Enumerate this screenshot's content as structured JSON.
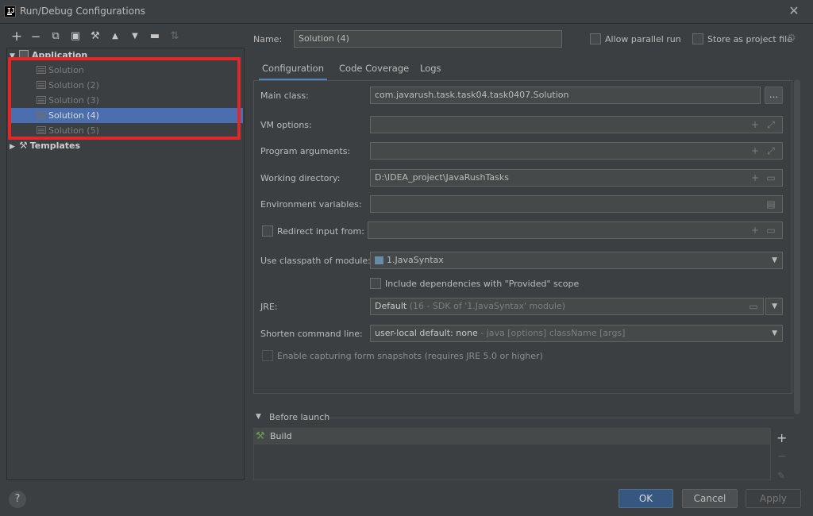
{
  "window": {
    "title": "Run/Debug Configurations",
    "logo_text": "IJ"
  },
  "toolbar": {
    "icons": [
      {
        "name": "add-icon",
        "glyph": "+"
      },
      {
        "name": "remove-icon",
        "glyph": "−"
      },
      {
        "name": "copy-icon",
        "glyph": "⧉"
      },
      {
        "name": "save-icon",
        "glyph": "▣"
      },
      {
        "name": "wrench-icon",
        "glyph": "🔧"
      },
      {
        "name": "move-up-icon",
        "glyph": "▲"
      },
      {
        "name": "move-down-icon",
        "glyph": "▼"
      },
      {
        "name": "new-folder-icon",
        "glyph": "▬"
      },
      {
        "name": "sort-icon",
        "glyph": "↓"
      }
    ]
  },
  "tree": {
    "application_label": "Application",
    "items": [
      "Solution",
      "Solution (2)",
      "Solution (3)",
      "Solution (4)",
      "Solution (5)"
    ],
    "selected_index": 3,
    "templates_label": "Templates"
  },
  "header": {
    "name_label": "Name:",
    "name_value": "Solution (4)",
    "allow_parallel_label": "Allow parallel run",
    "store_project_label": "Store as project file"
  },
  "tabs": [
    "Configuration",
    "Code Coverage",
    "Logs"
  ],
  "form": {
    "main_class_label": "Main class:",
    "main_class_value": "com.javarush.task.task04.task0407.Solution",
    "main_class_browse": "...",
    "vm_options_label": "VM options:",
    "program_args_label": "Program arguments:",
    "working_dir_label": "Working directory:",
    "working_dir_value": "D:\\IDEA_project\\JavaRushTasks",
    "env_vars_label": "Environment variables:",
    "redirect_label": "Redirect input from:",
    "classpath_label": "Use classpath of module:",
    "classpath_value": "1.JavaSyntax",
    "include_deps_label": "Include dependencies with \"Provided\" scope",
    "jre_label": "JRE:",
    "jre_default": "Default",
    "jre_detail": "(16 - SDK of '1.JavaSyntax' module)",
    "shorten_label": "Shorten command line:",
    "shorten_value": "user-local default: none",
    "shorten_detail": "- java [options] className [args]",
    "snapshots_label": "Enable capturing form snapshots (requires JRE 5.0 or higher)"
  },
  "before_launch": {
    "title": "Before launch",
    "items": [
      "Build"
    ]
  },
  "buttons": {
    "ok": "OK",
    "cancel": "Cancel",
    "apply": "Apply",
    "help": "?"
  },
  "colors": {
    "background": "#3c3f41",
    "selection": "#4b6eaf",
    "highlight": "#e32628",
    "accent": "#4a88c7"
  }
}
